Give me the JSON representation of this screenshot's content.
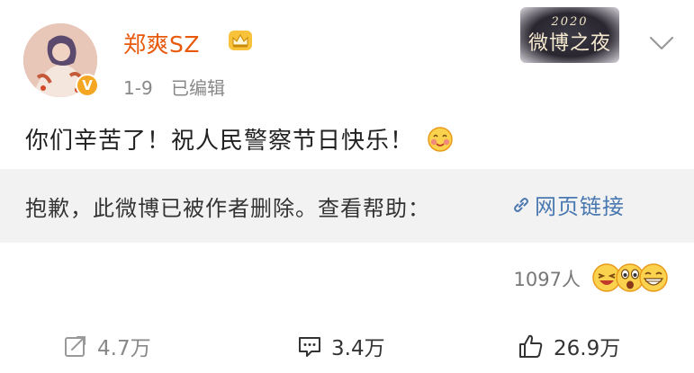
{
  "post": {
    "username": "郑爽SZ",
    "date": "1-9",
    "edited": "已编辑",
    "text": "你们辛苦了！祝人民警察节日快乐！",
    "verified_badge": "V",
    "user_level_icon": "crown-icon",
    "text_emoji": "blush-face-icon"
  },
  "event_logo": {
    "year": "2020",
    "name": "微博之夜"
  },
  "notice": {
    "text": "抱歉，此微博已被作者删除。查看帮助：",
    "link_label": "网页链接"
  },
  "reactions": {
    "count": "1097人",
    "icons": [
      "laughing-face-icon",
      "surprised-face-icon",
      "grinning-face-icon"
    ]
  },
  "actions": {
    "repost": "4.7万",
    "comment": "3.4万",
    "like": "26.9万"
  },
  "colors": {
    "username": "#e8590c",
    "link": "#4a78b0",
    "notice_background": "#f2f2f2",
    "verified_badge": "#f5a623"
  }
}
